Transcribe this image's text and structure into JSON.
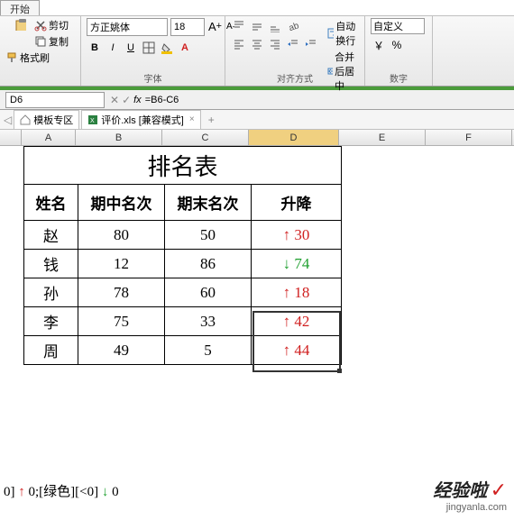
{
  "ribbon_tabs": {
    "active": "开始"
  },
  "clipboard": {
    "cut": "剪切",
    "copy": "复制",
    "format_painter": "格式刷",
    "group_label": ""
  },
  "font": {
    "name": "方正姚体",
    "size": "18",
    "bold": "B",
    "italic": "I",
    "underline": "U",
    "grow": "A",
    "shrink": "A",
    "group_label": "字体"
  },
  "align": {
    "wrap": "自动换行",
    "merge": "合并后居中",
    "group_label": "对齐方式"
  },
  "number": {
    "format": "自定义",
    "group_label": "数字"
  },
  "namebox": {
    "cell_ref": "D6",
    "fx": "fx",
    "formula": "=B6-C6"
  },
  "file_tabs": {
    "template": "模板专区",
    "file": "评价.xls",
    "mode": "[兼容模式]",
    "close": "×",
    "add": "+"
  },
  "columns": [
    "A",
    "B",
    "C",
    "D",
    "E",
    "F"
  ],
  "table": {
    "title": "排名表",
    "headers": [
      "姓名",
      "期中名次",
      "期末名次",
      "升降"
    ],
    "rows": [
      {
        "name": "赵",
        "mid": "80",
        "final": "50",
        "arrow": "↑",
        "delta": "30",
        "dir": "up"
      },
      {
        "name": "钱",
        "mid": "12",
        "final": "86",
        "arrow": "↓",
        "delta": "74",
        "dir": "down"
      },
      {
        "name": "孙",
        "mid": "78",
        "final": "60",
        "arrow": "↑",
        "delta": "18",
        "dir": "up"
      },
      {
        "name": "李",
        "mid": "75",
        "final": "33",
        "arrow": "↑",
        "delta": "42",
        "dir": "up"
      },
      {
        "name": "周",
        "mid": "49",
        "final": "5",
        "arrow": "↑",
        "delta": "44",
        "dir": "up"
      }
    ]
  },
  "bottom_format": {
    "p1": "0]",
    "p2": "↑",
    "p3": "0;[绿色][<0]",
    "p4": "↓",
    "p5": "0"
  },
  "watermark": {
    "big": "经验啦",
    "check": "✓",
    "small": "jingyanla.com"
  }
}
